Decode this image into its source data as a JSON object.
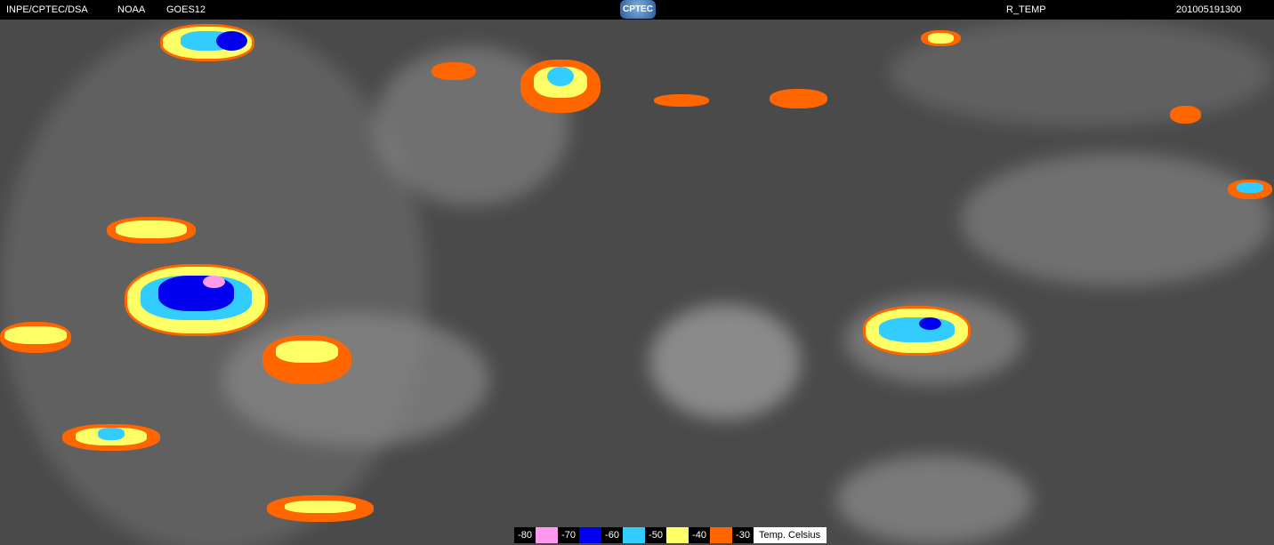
{
  "header": {
    "agency": "INPE/CPTEC/DSA",
    "source": "NOAA",
    "satellite": "GOES12",
    "logo": "CPTEC",
    "product": "R_TEMP",
    "datetime": "201005191300"
  },
  "legend": {
    "items": [
      {
        "label": "-80",
        "color": "#ff99ee"
      },
      {
        "label": "-70",
        "color": "#0000ee"
      },
      {
        "label": "-60",
        "color": "#33ccff"
      },
      {
        "label": "-50",
        "color": "#ffff66"
      },
      {
        "label": "-40",
        "color": "#ff6600"
      },
      {
        "label": "-30"
      }
    ],
    "unit": "Temp. Celsius"
  }
}
